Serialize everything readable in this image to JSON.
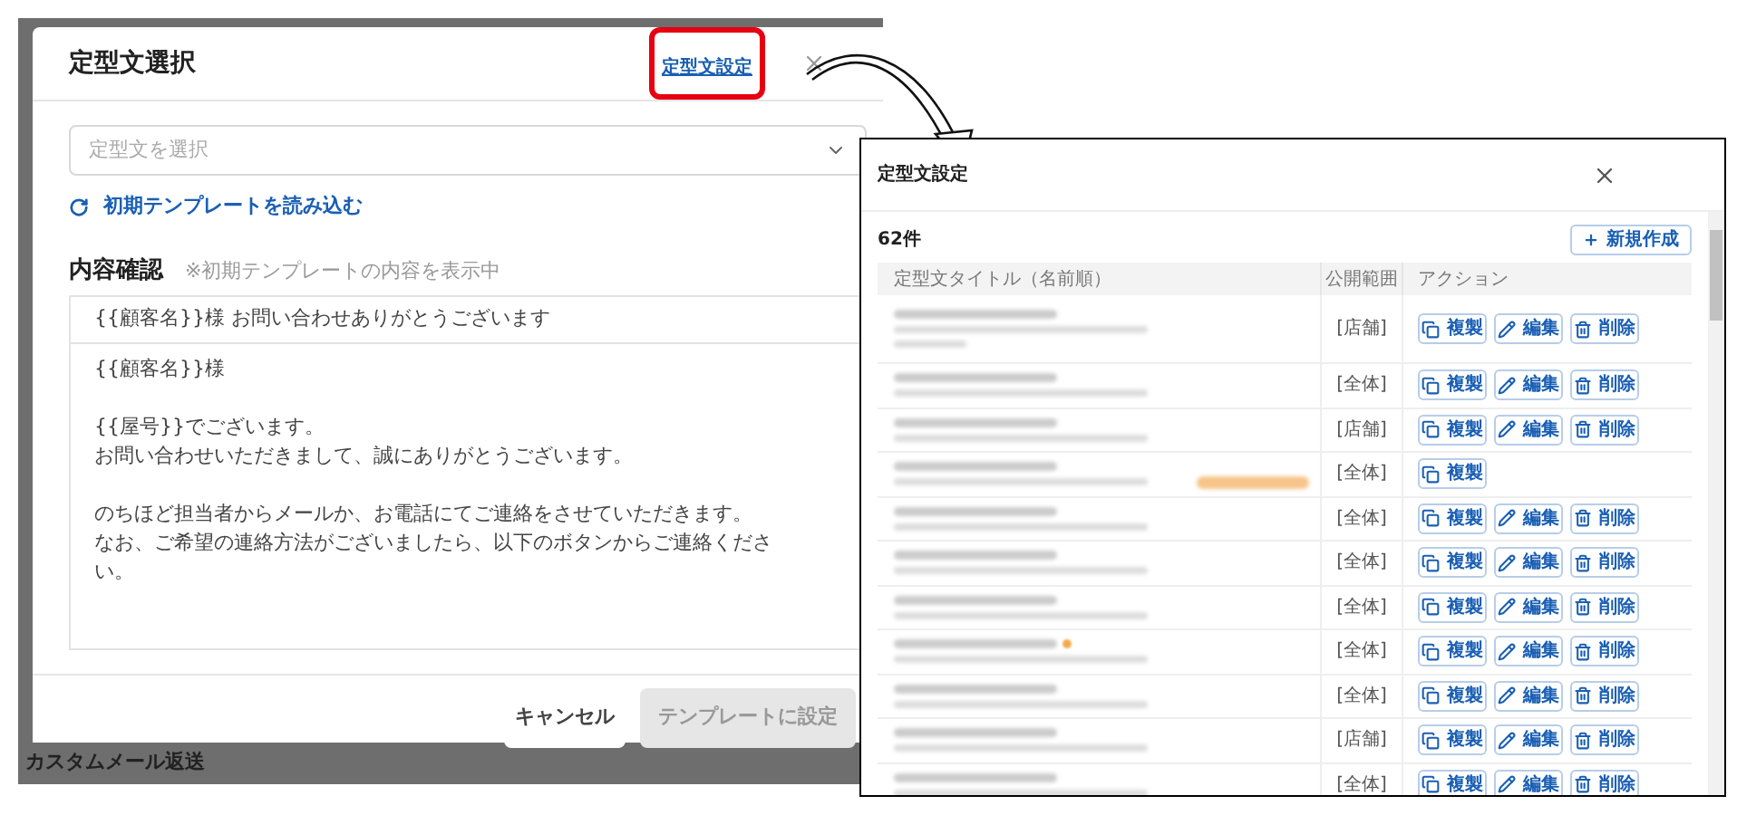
{
  "background_page": {
    "caption": "カスタムメール返送"
  },
  "select_dialog": {
    "title": "定型文選択",
    "settings_link": {
      "label": "定型文設定",
      "highlighted": true
    },
    "select": {
      "placeholder": "定型文を選択"
    },
    "reload_link": "初期テンプレートを読み込む",
    "preview": {
      "heading": "内容確認",
      "note": "※初期テンプレートの内容を表示中",
      "subject": "{{顧客名}}様 お問い合わせありがとうございます",
      "body_paragraphs": [
        [
          "{{顧客名}}様"
        ],
        [
          "{{屋号}}でございます。",
          "お問い合わせいただきまして、誠にありがとうございます。"
        ],
        [
          "のちほど担当者からメールか、お電話にてご連絡をさせていただきます。",
          "なお、ご希望の連絡方法がございましたら、以下のボタンからご連絡くださ",
          "い。"
        ]
      ]
    },
    "buttons": [
      {
        "label": "キャンセル",
        "disabled": false
      },
      {
        "label": "テンプレートに設定",
        "disabled": true
      }
    ]
  },
  "settings_dialog": {
    "title": "定型文設定",
    "count": "62件",
    "new_button": "新規作成",
    "columns": [
      "定型文タイトル（名前順）",
      "公開範囲",
      "アクション"
    ],
    "rows": [
      {
        "scope": "[店舗]",
        "tall": true,
        "tag": false,
        "marked": false,
        "actions": [
          {
            "kind": "copy",
            "label": "複製"
          },
          {
            "kind": "edit",
            "label": "編集"
          },
          {
            "kind": "delete",
            "label": "削除"
          }
        ]
      },
      {
        "scope": "[全体]",
        "tall": false,
        "tag": false,
        "marked": false,
        "actions": [
          {
            "kind": "copy",
            "label": "複製"
          },
          {
            "kind": "edit",
            "label": "編集"
          },
          {
            "kind": "delete",
            "label": "削除"
          }
        ]
      },
      {
        "scope": "[店舗]",
        "tall": false,
        "tag": false,
        "marked": false,
        "actions": [
          {
            "kind": "copy",
            "label": "複製"
          },
          {
            "kind": "edit",
            "label": "編集"
          },
          {
            "kind": "delete",
            "label": "削除"
          }
        ]
      },
      {
        "scope": "[全体]",
        "tall": false,
        "tag": true,
        "marked": false,
        "actions": [
          {
            "kind": "copy",
            "label": "複製"
          }
        ]
      },
      {
        "scope": "[全体]",
        "tall": false,
        "tag": false,
        "marked": false,
        "actions": [
          {
            "kind": "copy",
            "label": "複製"
          },
          {
            "kind": "edit",
            "label": "編集"
          },
          {
            "kind": "delete",
            "label": "削除"
          }
        ]
      },
      {
        "scope": "[全体]",
        "tall": false,
        "tag": false,
        "marked": false,
        "actions": [
          {
            "kind": "copy",
            "label": "複製"
          },
          {
            "kind": "edit",
            "label": "編集"
          },
          {
            "kind": "delete",
            "label": "削除"
          }
        ]
      },
      {
        "scope": "[全体]",
        "tall": false,
        "tag": false,
        "marked": false,
        "actions": [
          {
            "kind": "copy",
            "label": "複製"
          },
          {
            "kind": "edit",
            "label": "編集"
          },
          {
            "kind": "delete",
            "label": "削除"
          }
        ]
      },
      {
        "scope": "[全体]",
        "tall": false,
        "tag": false,
        "marked": true,
        "actions": [
          {
            "kind": "copy",
            "label": "複製"
          },
          {
            "kind": "edit",
            "label": "編集"
          },
          {
            "kind": "delete",
            "label": "削除"
          }
        ]
      },
      {
        "scope": "[全体]",
        "tall": false,
        "tag": false,
        "marked": false,
        "actions": [
          {
            "kind": "copy",
            "label": "複製"
          },
          {
            "kind": "edit",
            "label": "編集"
          },
          {
            "kind": "delete",
            "label": "削除"
          }
        ]
      },
      {
        "scope": "[店舗]",
        "tall": false,
        "tag": false,
        "marked": false,
        "actions": [
          {
            "kind": "copy",
            "label": "複製"
          },
          {
            "kind": "edit",
            "label": "編集"
          },
          {
            "kind": "delete",
            "label": "削除"
          }
        ]
      },
      {
        "scope": "[全体]",
        "tall": false,
        "tag": false,
        "marked": false,
        "actions": [
          {
            "kind": "copy",
            "label": "複製"
          },
          {
            "kind": "edit",
            "label": "編集"
          },
          {
            "kind": "delete",
            "label": "削除"
          }
        ]
      }
    ]
  }
}
